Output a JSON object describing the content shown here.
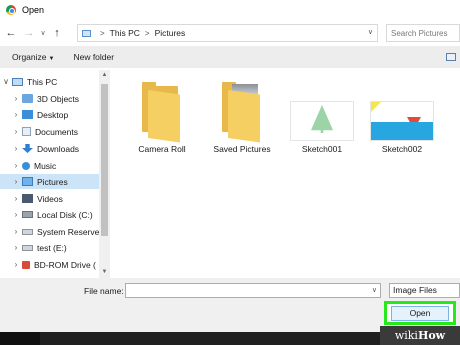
{
  "window": {
    "title": "Open",
    "app_icon": "chrome-icon"
  },
  "address": {
    "icons": {
      "back": "arrow-left-icon",
      "forward": "arrow-right-icon",
      "recent": "chevron-down-icon",
      "up": "arrow-up-icon"
    },
    "breadcrumb": [
      "This PC",
      "Pictures"
    ],
    "separator": ">",
    "search_placeholder": "Search Pictures"
  },
  "toolbar": {
    "organize_label": "Organize",
    "new_folder_label": "New folder"
  },
  "nav": {
    "items": [
      {
        "label": "This PC",
        "icon": "computer-icon",
        "expanded": true
      },
      {
        "label": "3D Objects",
        "icon": "cube-icon"
      },
      {
        "label": "Desktop",
        "icon": "desktop-icon"
      },
      {
        "label": "Documents",
        "icon": "documents-icon"
      },
      {
        "label": "Downloads",
        "icon": "download-icon"
      },
      {
        "label": "Music",
        "icon": "music-icon"
      },
      {
        "label": "Pictures",
        "icon": "pictures-icon",
        "selected": true
      },
      {
        "label": "Videos",
        "icon": "videos-icon"
      },
      {
        "label": "Local Disk (C:)",
        "icon": "disk-icon"
      },
      {
        "label": "System Reserved",
        "icon": "drive-icon"
      },
      {
        "label": "test (E:)",
        "icon": "drive-icon"
      },
      {
        "label": "BD-ROM Drive (",
        "icon": "bd-rom-icon"
      }
    ]
  },
  "files": [
    {
      "name": "Camera Roll",
      "kind": "folder"
    },
    {
      "name": "Saved Pictures",
      "kind": "folder-with-photo"
    },
    {
      "name": "Sketch001",
      "kind": "image-tree"
    },
    {
      "name": "Sketch002",
      "kind": "image-boat"
    }
  ],
  "footer": {
    "file_name_label": "File name:",
    "file_name_value": "",
    "file_type": "Image Files",
    "open_label": "Open"
  },
  "watermark": {
    "prefix": "wiki",
    "suffix": "How"
  },
  "colors": {
    "highlight": "#27e81a",
    "selection": "#cce4f7",
    "folder": "#e8b84a"
  }
}
